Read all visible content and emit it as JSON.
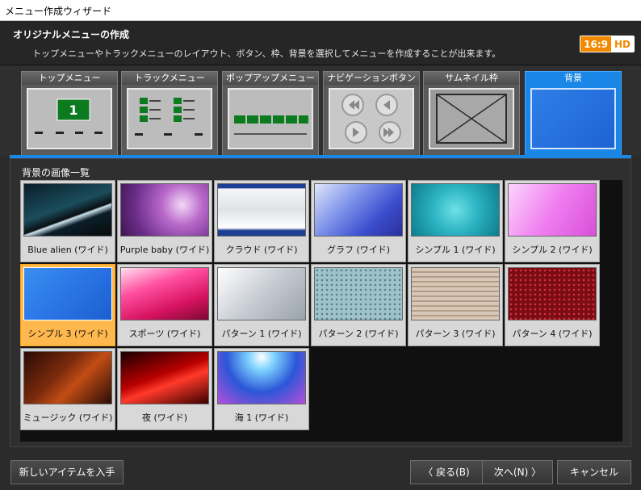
{
  "window": {
    "title": "メニュー作成ウィザード"
  },
  "header": {
    "title": "オリジナルメニューの作成",
    "description": "トップメニューやトラックメニューのレイアウト、ボタン、枠、背景を選択してメニューを作成することが出来ます。",
    "badge": {
      "ratio": "16:9",
      "hd": "HD"
    }
  },
  "tabs": [
    {
      "label": "トップメニュー",
      "active": false
    },
    {
      "label": "トラックメニュー",
      "active": false
    },
    {
      "label": "ポップアップメニュー",
      "active": false
    },
    {
      "label": "ナビゲーションボタン",
      "active": false
    },
    {
      "label": "サムネイル枠",
      "active": false
    },
    {
      "label": "背景",
      "active": true
    }
  ],
  "panel": {
    "title": "背景の画像一覧"
  },
  "backgrounds": [
    {
      "label": "Blue alien (ワイド)",
      "selected": false
    },
    {
      "label": "Purple baby (ワイド)",
      "selected": false
    },
    {
      "label": "クラウド (ワイド)",
      "selected": false
    },
    {
      "label": "グラフ (ワイド)",
      "selected": false
    },
    {
      "label": "シンプル 1 (ワイド)",
      "selected": false
    },
    {
      "label": "シンプル 2 (ワイド)",
      "selected": false
    },
    {
      "label": "シンプル 3 (ワイド)",
      "selected": true
    },
    {
      "label": "スポーツ (ワイド)",
      "selected": false
    },
    {
      "label": "パターン 1 (ワイド)",
      "selected": false
    },
    {
      "label": "パターン 2 (ワイド)",
      "selected": false
    },
    {
      "label": "パターン 3 (ワイド)",
      "selected": false
    },
    {
      "label": "パターン 4 (ワイド)",
      "selected": false
    },
    {
      "label": "ミュージック (ワイド)",
      "selected": false
    },
    {
      "label": "夜 (ワイド)",
      "selected": false
    },
    {
      "label": "海 1 (ワイド)",
      "selected": false
    }
  ],
  "footer": {
    "new_items": "新しいアイテムを入手",
    "back": "〈 戻る(B)",
    "next": "次へ(N) 〉",
    "cancel": "キャンセル"
  },
  "colors": {
    "accent": "#1a86e6",
    "selected": "#ffb84d",
    "badge": "#f28a00"
  }
}
